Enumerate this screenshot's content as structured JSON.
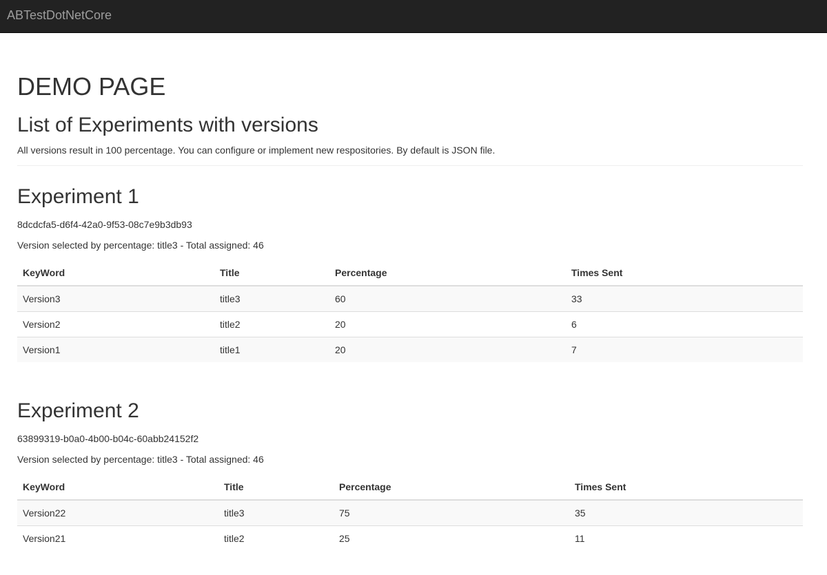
{
  "navbar": {
    "brand": "ABTestDotNetCore"
  },
  "page": {
    "title": "DEMO PAGE",
    "subtitle": "List of Experiments with versions",
    "intro": "All versions result in 100 percentage. You can configure or implement new respositories. By default is JSON file."
  },
  "table_headers": [
    "KeyWord",
    "Title",
    "Percentage",
    "Times Sent"
  ],
  "experiments": [
    {
      "name": "Experiment 1",
      "guid": "8dcdcfa5-d6f4-42a0-9f53-08c7e9b3db93",
      "selected": "Version selected by percentage: title3 - Total assigned: 46",
      "rows": [
        [
          "Version3",
          "title3",
          "60",
          "33"
        ],
        [
          "Version2",
          "title2",
          "20",
          "6"
        ],
        [
          "Version1",
          "title1",
          "20",
          "7"
        ]
      ]
    },
    {
      "name": "Experiment 2",
      "guid": "63899319-b0a0-4b00-b04c-60abb24152f2",
      "selected": "Version selected by percentage: title3 - Total assigned: 46",
      "rows": [
        [
          "Version22",
          "title3",
          "75",
          "35"
        ],
        [
          "Version21",
          "title2",
          "25",
          "11"
        ]
      ]
    }
  ]
}
